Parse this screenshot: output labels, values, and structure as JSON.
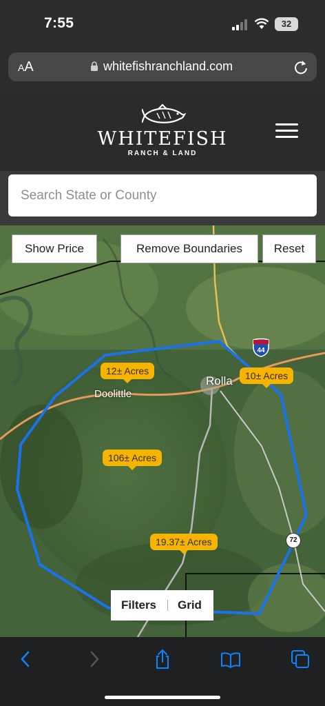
{
  "status_bar": {
    "time": "7:55",
    "battery": "32"
  },
  "browser": {
    "text_size_small": "A",
    "text_size_large": "A",
    "url": "whitefishranchland.com"
  },
  "brand": {
    "name": "WHITEFISH",
    "tagline": "RANCH & LAND"
  },
  "search": {
    "placeholder": "Search State or County"
  },
  "map_controls": {
    "show_price": "Show Price",
    "remove_boundaries": "Remove Boundaries",
    "reset": "Reset"
  },
  "listings": [
    {
      "label": "12± Acres"
    },
    {
      "label": "10± Acres"
    },
    {
      "label": "106± Acres"
    },
    {
      "label": "19.37± Acres"
    }
  ],
  "places": {
    "doolittle": "Doolittle",
    "rolla": "Rolla"
  },
  "road_signs": {
    "interstate": "44",
    "state_route": "72"
  },
  "bottom_filters": {
    "filters": "Filters",
    "grid": "Grid"
  },
  "colors": {
    "boundary": "#1a73e8",
    "acre_badge": "#f5b400",
    "header_bg": "#2a2b2d",
    "accent_blue": "#0a84ff"
  },
  "icons": [
    "back-icon",
    "forward-icon",
    "share-icon",
    "bookmarks-icon",
    "tabs-icon",
    "lock-icon",
    "reload-icon",
    "menu-icon",
    "fish-logo-icon"
  ]
}
